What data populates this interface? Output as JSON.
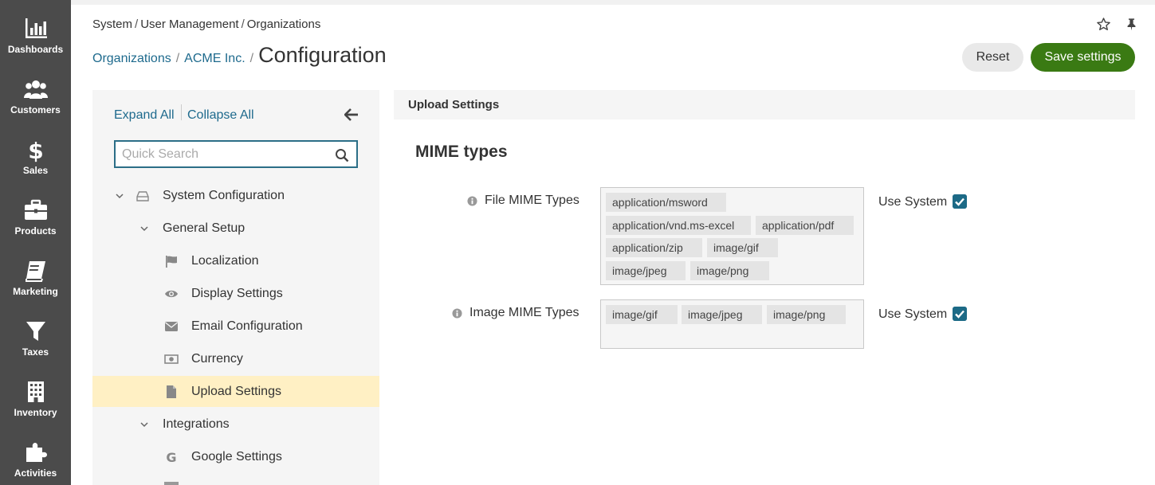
{
  "sidebar": {
    "items": [
      {
        "label": "Dashboards",
        "icon": "chart-bar-icon"
      },
      {
        "label": "Customers",
        "icon": "users-icon"
      },
      {
        "label": "Sales",
        "icon": "dollar-icon"
      },
      {
        "label": "Products",
        "icon": "briefcase-icon"
      },
      {
        "label": "Marketing",
        "icon": "book-icon"
      },
      {
        "label": "Taxes",
        "icon": "filter-icon"
      },
      {
        "label": "Inventory",
        "icon": "building-icon"
      },
      {
        "label": "Activities",
        "icon": "puzzle-icon"
      }
    ]
  },
  "breadcrumb": {
    "items": [
      "System",
      "User Management",
      "Organizations"
    ],
    "separator": "/"
  },
  "title": {
    "link1": "Organizations",
    "link2": "ACME Inc.",
    "separator": "/",
    "page_title": "Configuration"
  },
  "actions": {
    "reset_label": "Reset",
    "save_label": "Save settings"
  },
  "tree": {
    "expand_all": "Expand All",
    "collapse_all": "Collapse All",
    "search_placeholder": "Quick Search",
    "nodes": [
      {
        "label": "System Configuration",
        "icon": "drive-icon"
      },
      {
        "label": "General Setup"
      },
      {
        "label": "Localization",
        "icon": "flag-icon"
      },
      {
        "label": "Display Settings",
        "icon": "eye-icon"
      },
      {
        "label": "Email Configuration",
        "icon": "envelope-icon"
      },
      {
        "label": "Currency",
        "icon": "money-icon"
      },
      {
        "label": "Upload Settings",
        "icon": "file-icon",
        "active": true
      },
      {
        "label": "Integrations"
      },
      {
        "label": "Google Settings",
        "icon": "google-icon"
      }
    ]
  },
  "main": {
    "section_title": "Upload Settings",
    "heading": "MIME types",
    "file_mime": {
      "label": "File MIME Types",
      "tags": [
        "application/msword",
        "application/vnd.ms-excel",
        "application/pdf",
        "application/zip",
        "image/gif",
        "image/jpeg",
        "image/png"
      ],
      "use_system_label": "Use System",
      "use_system": true
    },
    "image_mime": {
      "label": "Image MIME Types",
      "tags": [
        "image/gif",
        "image/jpeg",
        "image/png"
      ],
      "use_system_label": "Use System",
      "use_system": true
    }
  },
  "colors": {
    "sidebar_bg": "#4b4b4b",
    "link": "#1e6a8d",
    "primary_button": "#3a7a13",
    "active_row": "#fff0c4",
    "checkbox": "#1c6a86"
  }
}
